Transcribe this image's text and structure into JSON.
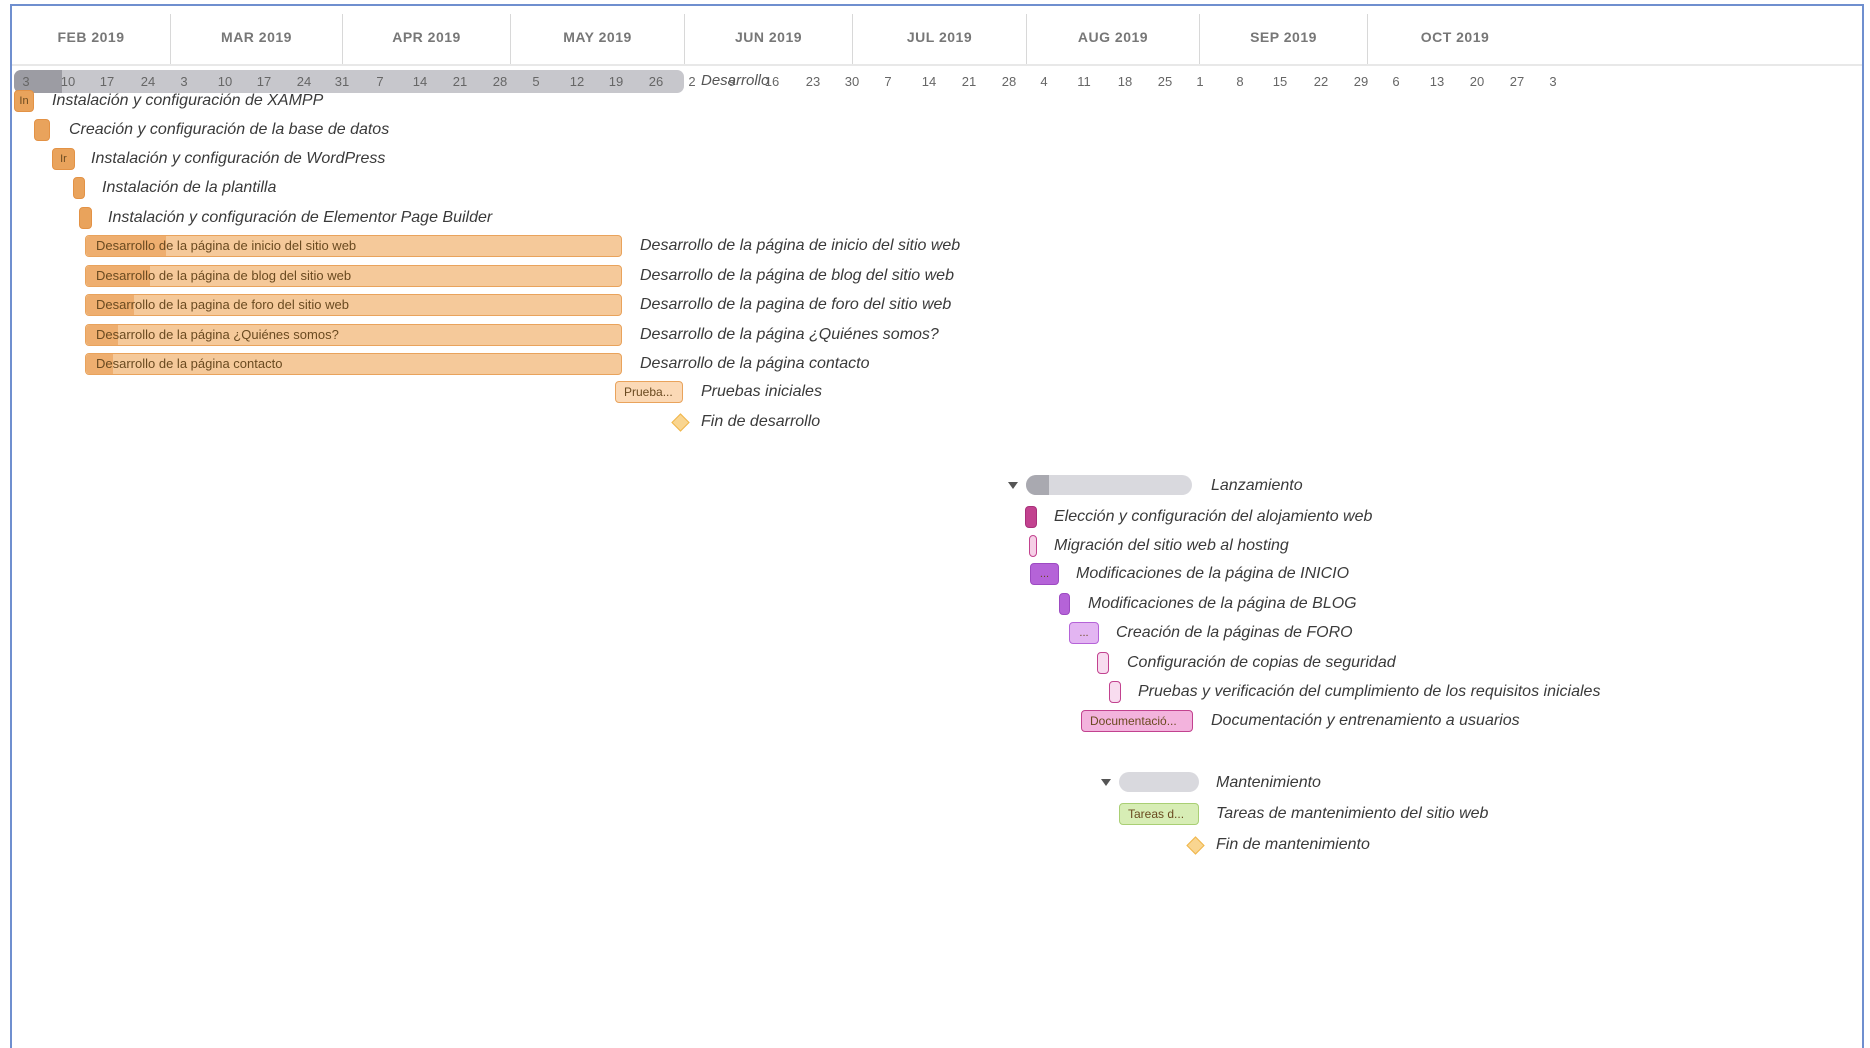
{
  "timeline": {
    "months": [
      "FEB 2019",
      "MAR 2019",
      "APR 2019",
      "MAY 2019",
      "JUN 2019",
      "JUL 2019",
      "AUG 2019",
      "SEP 2019",
      "OCT 2019"
    ],
    "weeks": [
      "3",
      "10",
      "17",
      "24",
      "3",
      "10",
      "17",
      "24",
      "31",
      "7",
      "14",
      "21",
      "28",
      "5",
      "12",
      "19",
      "26",
      "2",
      "9",
      "16",
      "23",
      "30",
      "7",
      "14",
      "21",
      "28",
      "4",
      "11",
      "18",
      "25",
      "1",
      "8",
      "15",
      "22",
      "29",
      "6",
      "13",
      "20",
      "27",
      "3"
    ],
    "collapsed_phase": {
      "label": "Desarrollo"
    }
  },
  "tasks": [
    {
      "id": "t1",
      "name": "Instalación y configuración de XAMPP",
      "bar_text": "In",
      "color": "#e9a35c",
      "border": "#e39245"
    },
    {
      "id": "t2",
      "name": "Creación y configuración de la base de datos",
      "bar_text": "",
      "color": "#e9a35c",
      "border": "#e39245"
    },
    {
      "id": "t3",
      "name": "Instalación y configuración de WordPress",
      "bar_text": "Ir",
      "color": "#e9a35c",
      "border": "#e39245"
    },
    {
      "id": "t4",
      "name": "Instalación de la plantilla",
      "bar_text": "",
      "color": "#e9a35c",
      "border": "#e39245"
    },
    {
      "id": "t5",
      "name": "Instalación y configuración de Elementor Page Builder",
      "bar_text": "",
      "color": "#e9a35c",
      "border": "#e39245"
    },
    {
      "id": "t6",
      "name": "Desarrollo de la página de inicio del sitio web",
      "bar_text": "Desarrollo de la página de inicio del sitio web",
      "color": "#f5c99a",
      "border": "#e9a35c",
      "progress_color": "#eeae6f",
      "progress": 0.15
    },
    {
      "id": "t7",
      "name": "Desarrollo de la página de blog del sitio web",
      "bar_text": "Desarrollo de la página de blog del sitio web",
      "color": "#f5c99a",
      "border": "#e9a35c",
      "progress_color": "#eeae6f",
      "progress": 0.12
    },
    {
      "id": "t8",
      "name": "Desarrollo de la pagina de foro del sitio web",
      "bar_text": "Desarrollo de la pagina de foro del sitio web",
      "color": "#f5c99a",
      "border": "#e9a35c",
      "progress_color": "#eeae6f",
      "progress": 0.09
    },
    {
      "id": "t9",
      "name": "Desarrollo de la página ¿Quiénes somos?",
      "bar_text": "Desarrollo de la página ¿Quiénes somos?",
      "color": "#f5c99a",
      "border": "#e9a35c",
      "progress_color": "#eeae6f",
      "progress": 0.06
    },
    {
      "id": "t10",
      "name": "Desarrollo de la página contacto",
      "bar_text": "Desarrollo de la página contacto",
      "color": "#f5c99a",
      "border": "#e9a35c",
      "progress_color": "#eeae6f",
      "progress": 0.05
    },
    {
      "id": "t11",
      "name": "Pruebas iniciales",
      "bar_text": "Prueba...",
      "color": "#fbd9b6",
      "border": "#e9a35c"
    },
    {
      "id": "m1",
      "name": "Fin de desarrollo",
      "type": "milestone"
    },
    {
      "id": "g1",
      "name": "Lanzamiento",
      "type": "group",
      "progress": 0.14
    },
    {
      "id": "t12",
      "name": "Elección y configuración del alojamiento web",
      "bar_text": "",
      "color": "#c2428f",
      "border": "#a8307a"
    },
    {
      "id": "t13",
      "name": "Migración del sitio web al hosting",
      "bar_text": "",
      "color": "#f6cfe6",
      "border": "#c2428f"
    },
    {
      "id": "t14",
      "name": "Modificaciones de la página de INICIO",
      "bar_text": "...",
      "color": "#b563d8",
      "border": "#9d4ac2"
    },
    {
      "id": "t15",
      "name": "Modificaciones de la página de BLOG",
      "bar_text": "",
      "color": "#b563d8",
      "border": "#9d4ac2"
    },
    {
      "id": "t16",
      "name": "Creación de la páginas de FORO",
      "bar_text": "...",
      "color": "#e3b5f2",
      "border": "#b563d8"
    },
    {
      "id": "t17",
      "name": "Configuración de copias de seguridad",
      "bar_text": "",
      "color": "#f8dcef",
      "border": "#c2428f"
    },
    {
      "id": "t18",
      "name": "Pruebas y verificación del cumplimiento de los requisitos iniciales",
      "bar_text": "",
      "color": "#f8dcef",
      "border": "#c2428f"
    },
    {
      "id": "t19",
      "name": "Documentación y entrenamiento a usuarios",
      "bar_text": "Documentació...",
      "color": "#f3b3dd",
      "border": "#c2428f"
    },
    {
      "id": "g2",
      "name": "Mantenimiento",
      "type": "group",
      "progress": 0.0
    },
    {
      "id": "t20",
      "name": "Tareas de mantenimiento del sitio web",
      "bar_text": "Tareas d...",
      "color": "#d7edb5",
      "border": "#a9cf74"
    },
    {
      "id": "m2",
      "name": "Fin de mantenimiento",
      "type": "milestone"
    }
  ]
}
